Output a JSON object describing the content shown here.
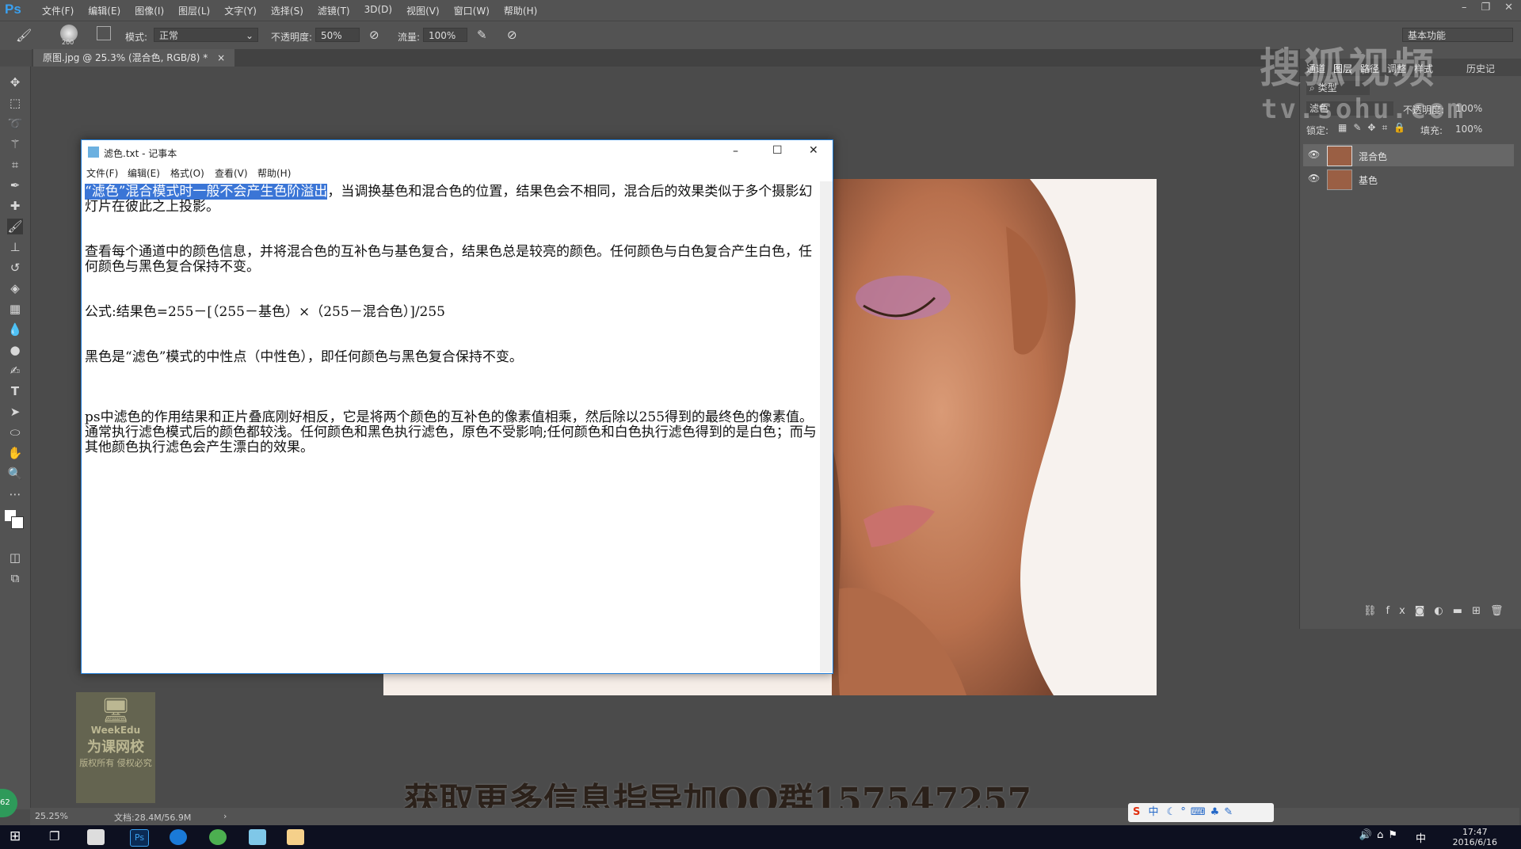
{
  "app": {
    "logo": "Ps",
    "menus": [
      "文件(F)",
      "编辑(E)",
      "图像(I)",
      "图层(L)",
      "文字(Y)",
      "选择(S)",
      "滤镜(T)",
      "3D(D)",
      "视图(V)",
      "窗口(W)",
      "帮助(H)"
    ],
    "workspace": "基本功能"
  },
  "options_bar": {
    "brush_size": "200",
    "mode_label": "模式:",
    "mode_value": "正常",
    "opacity_label": "不透明度:",
    "opacity_value": "50%",
    "flow_label": "流量:",
    "flow_value": "100%"
  },
  "document_tab": {
    "title": "原图.jpg @ 25.3% (混合色, RGB/8) *",
    "close": "×"
  },
  "notepad": {
    "title": "滤色.txt - 记事本",
    "menus": [
      "文件(F)",
      "编辑(E)",
      "格式(O)",
      "查看(V)",
      "帮助(H)"
    ],
    "selected_text": "“滤色”混合模式时一般不会产生色阶溢出",
    "para1_rest": "，当调换基色和混合色的位置，结果色会不相同，混合后的效果类似于多个摄影幻灯片在彼此之上投影。",
    "para2": "查看每个通道中的颜色信息，并将混合色的互补色与基色复合，结果色总是较亮的颜色。任何颜色与白色复合产生白色，任何颜色与黑色复合保持不变。",
    "para3": "公式:结果色=255－[（255－基色）×（255－混合色）]/255",
    "para4": "黑色是“滤色”模式的中性点（中性色），即任何颜色与黑色复合保持不变。",
    "para5": "ps中滤色的作用结果和正片叠底刚好相反，它是将两个颜色的互补色的像素值相乘，然后除以255得到的最终色的像素值。通常执行滤色模式后的颜色都较浅。任何颜色和黑色执行滤色，原色不受影响;任何颜色和白色执行滤色得到的是白色；而与其他颜色执行滤色会产生漂白的效果。"
  },
  "layers_panel": {
    "tabs": [
      "通道",
      "图层",
      "路径",
      "调整",
      "样式",
      "历史记"
    ],
    "filter_label": "类型",
    "blend_mode": "滤色",
    "opacity_label": "不透明度:",
    "opacity_value": "100%",
    "lock_label": "锁定:",
    "fill_label": "填充:",
    "fill_value": "100%",
    "layers": [
      {
        "name": "混合色",
        "selected": true
      },
      {
        "name": "基色",
        "selected": false
      }
    ]
  },
  "status_bar": {
    "zoom": "25.25%",
    "doc_size": "文档:28.4M/56.9M"
  },
  "watermark": {
    "line1": "搜狐视频",
    "line2": "tv.sohu.com"
  },
  "banner": "获取更多信息指导加QQ群157547257",
  "weekedu": {
    "brand": "WeekEdu",
    "name": "为课网校",
    "rights1": "版权所有",
    "rights2": "侵权必究"
  },
  "badge": "62",
  "taskbar": {
    "time": "17:47",
    "date": "2016/6/16",
    "ime": "中"
  },
  "colors": {
    "accent": "#3a75d6",
    "ps_blue": "#3aa0f0",
    "panel": "#535353"
  }
}
